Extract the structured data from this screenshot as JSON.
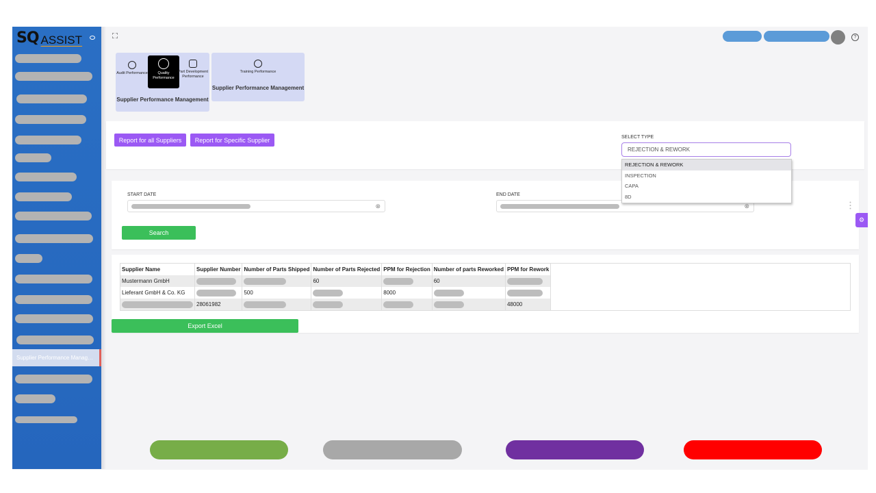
{
  "brand": {
    "logo_sq": "SQ",
    "logo_assist": "ASSIST"
  },
  "sidebar": {
    "active_item": "Supplier Performance Management"
  },
  "modules": [
    {
      "items": [
        {
          "label": "Audit Performance",
          "icon": "target-icon"
        },
        {
          "label": "Quality Performance",
          "icon": "gear-icon",
          "active": true
        },
        {
          "label": "Part Development Performance",
          "icon": "document-icon"
        }
      ],
      "title": "Supplier Performance Management"
    },
    {
      "items": [
        {
          "label": "Training Performance",
          "icon": "training-icon"
        }
      ],
      "title": "Supplier Performance Management"
    }
  ],
  "report": {
    "all_suppliers_label": "Report for all Suppliers",
    "specific_supplier_label": "Report for Specific Supplier"
  },
  "select_type": {
    "label": "SELECT TYPE",
    "value": "REJECTION & REWORK",
    "options": [
      "REJECTION & REWORK",
      "INSPECTION",
      "CAPA",
      "8D"
    ]
  },
  "dates": {
    "start_label": "START DATE",
    "end_label": "END DATE",
    "clear_glyph": "⊗"
  },
  "search_label": "Search",
  "table": {
    "headers": [
      "Supplier Name",
      "Supplier Number",
      "Number of Parts Shipped",
      "Number of Parts Rejected",
      "PPM for Rejection",
      "Number of parts Reworked",
      "PPM for Rework"
    ],
    "rows": [
      [
        "Mustermann GmbH",
        "",
        "",
        "60",
        "",
        "60",
        ""
      ],
      [
        "Lieferant GmbH & Co. KG",
        "",
        "500",
        "",
        "8000",
        "",
        ""
      ],
      [
        "",
        "28061982",
        "",
        "",
        "",
        "",
        "48000"
      ]
    ]
  },
  "export_label": "Export Excel",
  "help_glyph": "?",
  "colors": {
    "sidebar": "#2a6fc4",
    "accent_purple": "#9b59f4",
    "accent_green": "#3bbf5a",
    "pill_green": "#77ad48",
    "pill_gray": "#a8a8a8",
    "pill_purple": "#7030a0",
    "pill_red": "#ff0000"
  }
}
